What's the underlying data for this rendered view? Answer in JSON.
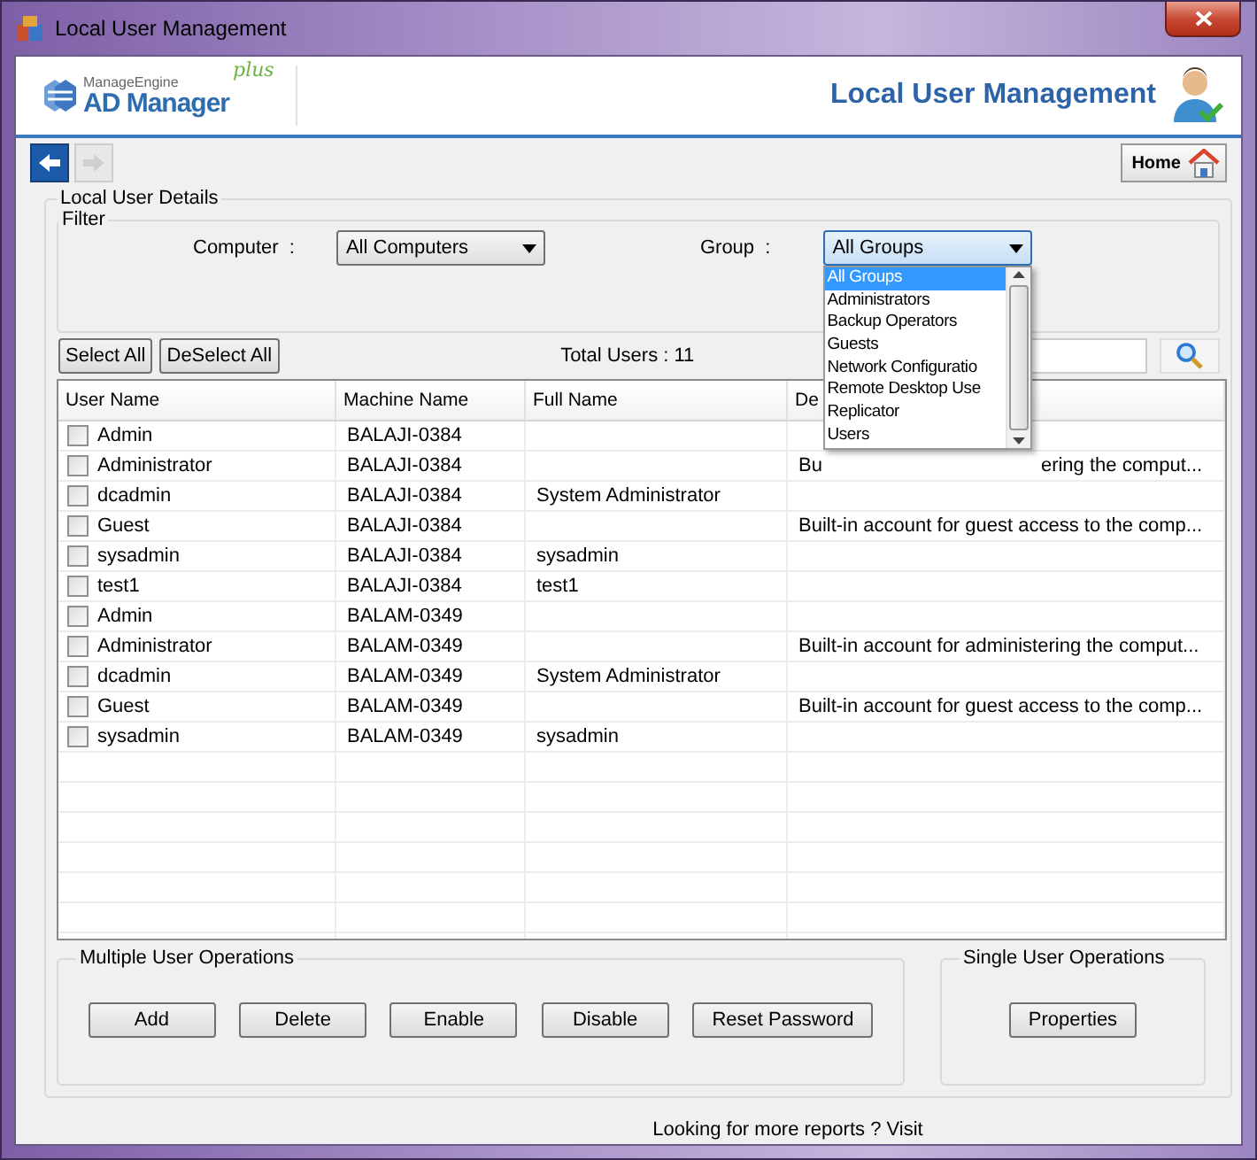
{
  "window": {
    "title": "Local User Management"
  },
  "header": {
    "vendor": "ManageEngine",
    "product": "AD Manager",
    "edition": "plus",
    "title": "Local User Management"
  },
  "nav": {
    "back_enabled": true,
    "forward_enabled": false,
    "home": "Home"
  },
  "details": {
    "title": "Local User Details"
  },
  "filter": {
    "title": "Filter",
    "computer_label": "Computer  :",
    "computer_value": "All Computers",
    "group_label": "Group  :",
    "group_value": "All Groups",
    "group_open": true
  },
  "group_options": [
    {
      "label": "All Groups",
      "selected": true
    },
    {
      "label": "Administrators",
      "selected": false
    },
    {
      "label": "Backup Operators",
      "selected": false
    },
    {
      "label": "Guests",
      "selected": false
    },
    {
      "label": "Network Configuratio",
      "selected": false
    },
    {
      "label": "Remote Desktop Use",
      "selected": false
    },
    {
      "label": "Replicator",
      "selected": false
    },
    {
      "label": "Users",
      "selected": false
    }
  ],
  "toolbar": {
    "select_all": "Select All",
    "deselect_all": "DeSelect All",
    "total": "Total Users : 11"
  },
  "table": {
    "columns": [
      "User Name",
      "Machine Name",
      "Full Name",
      "De"
    ],
    "rows": [
      {
        "checked": false,
        "user": "Admin",
        "machine": "BALAJI-0384",
        "full_name": "",
        "description": []
      },
      {
        "checked": false,
        "user": "Administrator",
        "machine": "BALAJI-0384",
        "full_name": "",
        "description": [
          "Bu",
          "ering the comput..."
        ]
      },
      {
        "checked": false,
        "user": "dcadmin",
        "machine": "BALAJI-0384",
        "full_name": "System Administrator",
        "description": []
      },
      {
        "checked": false,
        "user": "Guest",
        "machine": "BALAJI-0384",
        "full_name": "",
        "description": [
          "Built-in account for guest access to the comp..."
        ]
      },
      {
        "checked": false,
        "user": "sysadmin",
        "machine": "BALAJI-0384",
        "full_name": "sysadmin",
        "description": []
      },
      {
        "checked": false,
        "user": "test1",
        "machine": "BALAJI-0384",
        "full_name": "test1",
        "description": []
      },
      {
        "checked": false,
        "user": "Admin",
        "machine": "BALAM-0349",
        "full_name": "",
        "description": []
      },
      {
        "checked": false,
        "user": "Administrator",
        "machine": "BALAM-0349",
        "full_name": "",
        "description": [
          "Built-in account for administering the comput..."
        ]
      },
      {
        "checked": false,
        "user": "dcadmin",
        "machine": "BALAM-0349",
        "full_name": "System Administrator",
        "description": []
      },
      {
        "checked": false,
        "user": "Guest",
        "machine": "BALAM-0349",
        "full_name": "",
        "description": [
          "Built-in account for guest access to the comp..."
        ]
      },
      {
        "checked": false,
        "user": "sysadmin",
        "machine": "BALAM-0349",
        "full_name": "sysadmin",
        "description": []
      }
    ]
  },
  "multiple_ops": {
    "title": "Multiple User Operations",
    "buttons": [
      "Add",
      "Delete",
      "Enable",
      "Disable",
      "Reset Password"
    ]
  },
  "single_ops": {
    "title": "Single User Operations",
    "buttons": [
      "Properties"
    ]
  },
  "footer": "Looking for more reports ? Visit"
}
